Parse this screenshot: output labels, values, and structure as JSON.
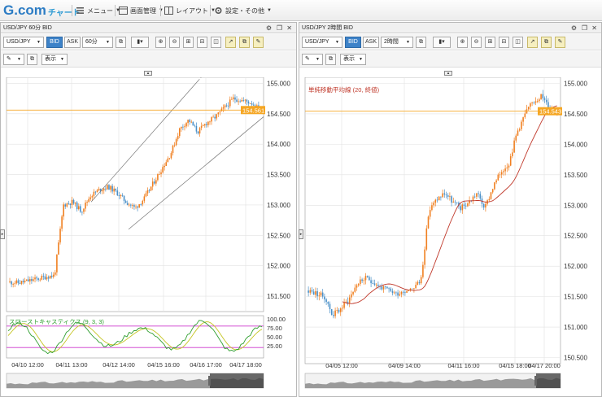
{
  "app": {
    "logo_main": "G.com",
    "logo_sub": "チャート"
  },
  "menu": [
    {
      "label": "メニュー",
      "icon": "menu-icon"
    },
    {
      "label": "画面管理",
      "icon": "screen-manage-icon"
    },
    {
      "label": "レイアウト",
      "icon": "layout-icon"
    },
    {
      "label": "設定・その他",
      "icon": "gear-icon"
    }
  ],
  "colors": {
    "up": "#f07f20",
    "down": "#4a90c8",
    "price_line": "#f5a623",
    "ma": "#c0392b",
    "stoch_k": "#2e9e2e",
    "stoch_d": "#c5c523",
    "stoch_band": "#cc33cc",
    "accent": "#3d82c8"
  },
  "left": {
    "title": "USD/JPY 60分 BID",
    "symbol": "USD/JPY",
    "bid_label": "BID",
    "ask_label": "ASK",
    "interval": "60分",
    "display_label": "表示",
    "current_price": "154.561",
    "y_ticks": [
      "155.000",
      "154.500",
      "154.000",
      "153.500",
      "153.000",
      "152.500",
      "152.000",
      "151.500"
    ],
    "x_ticks": [
      "04/10 12:00",
      "04/11 13:00",
      "04/12 14:00",
      "04/15 16:00",
      "04/16 17:00",
      "04/17 18:00"
    ],
    "indicator_label": "スローストキャスティクス (9, 3, 3)",
    "indicator_ticks": [
      "100.00",
      "75.00",
      "50.00",
      "25.00"
    ]
  },
  "right": {
    "title": "USD/JPY 2時間 BID",
    "symbol": "USD/JPY",
    "bid_label": "BID",
    "ask_label": "ASK",
    "interval": "2時間",
    "display_label": "表示",
    "current_price": "154.543",
    "ma_label": "単純移動平均線 (20, 終値)",
    "y_ticks": [
      "155.000",
      "154.500",
      "154.000",
      "153.500",
      "153.000",
      "152.500",
      "152.000",
      "151.500",
      "151.000",
      "150.500"
    ],
    "x_ticks": [
      "04/05 12:00",
      "04/09 14:00",
      "04/11 16:00",
      "04/15 18:00",
      "04/17 20:00"
    ]
  },
  "chart_data": [
    {
      "type": "candlestick",
      "title": "USD/JPY 60分 BID",
      "ylim": [
        151.3,
        155.1
      ],
      "close_path": [
        151.73,
        151.72,
        151.75,
        151.78,
        151.82,
        151.84,
        153.0,
        153.05,
        152.9,
        153.15,
        153.25,
        153.3,
        153.2,
        153.05,
        152.95,
        153.1,
        153.35,
        153.6,
        153.85,
        154.25,
        154.4,
        154.2,
        154.35,
        154.45,
        154.6,
        154.75,
        154.72,
        154.68,
        154.56
      ],
      "x_labels": [
        "04/10 12:00",
        "04/11 13:00",
        "04/12 14:00",
        "04/15 16:00",
        "04/16 17:00",
        "04/17 18:00"
      ]
    },
    {
      "type": "candlestick",
      "title": "USD/JPY 2時間 BID",
      "ylim": [
        150.4,
        155.1
      ],
      "close_path": [
        151.6,
        151.55,
        151.5,
        151.2,
        151.3,
        151.45,
        151.7,
        151.8,
        151.75,
        151.65,
        151.6,
        151.55,
        151.6,
        151.65,
        151.75,
        152.9,
        153.1,
        153.2,
        153.05,
        152.95,
        153.05,
        153.2,
        152.95,
        153.3,
        153.55,
        153.7,
        154.2,
        154.5,
        154.7,
        154.8,
        154.6,
        154.54
      ],
      "x_labels": [
        "04/05 12:00",
        "04/09 14:00",
        "04/11 16:00",
        "04/15 18:00",
        "04/17 20:00"
      ]
    }
  ]
}
